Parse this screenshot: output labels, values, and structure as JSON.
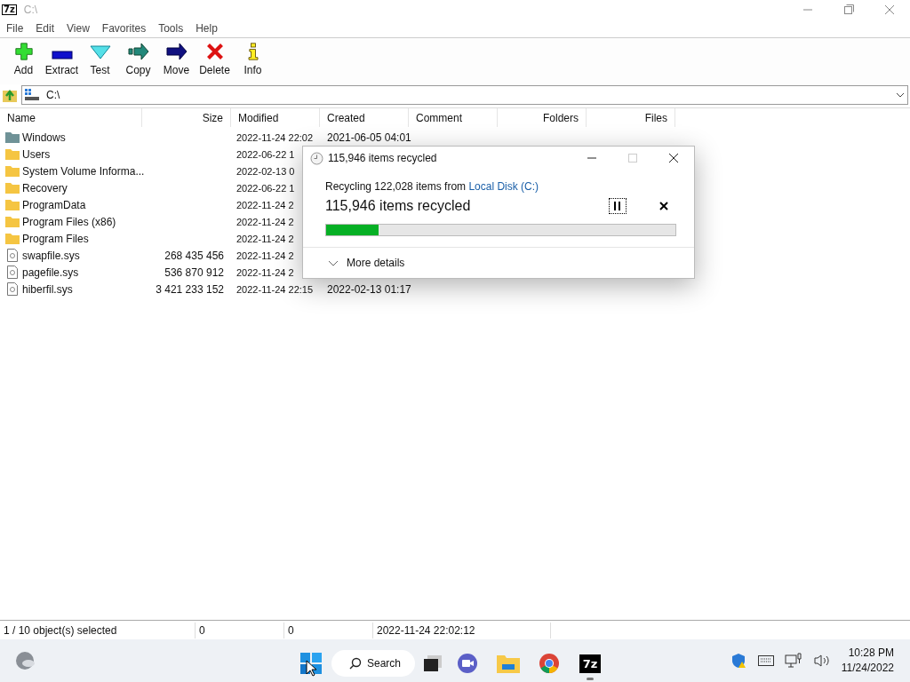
{
  "window": {
    "logo": "7z",
    "title": "C:\\"
  },
  "menu": [
    "File",
    "Edit",
    "View",
    "Favorites",
    "Tools",
    "Help"
  ],
  "toolbar": [
    {
      "kind": "add",
      "label": "Add"
    },
    {
      "kind": "extract",
      "label": "Extract"
    },
    {
      "kind": "test",
      "label": "Test"
    },
    {
      "kind": "copy",
      "label": "Copy"
    },
    {
      "kind": "move",
      "label": "Move"
    },
    {
      "kind": "delete",
      "label": "Delete"
    },
    {
      "kind": "info",
      "label": "Info"
    }
  ],
  "address": {
    "value": "C:\\"
  },
  "table": {
    "columns": [
      "Name",
      "Size",
      "Modified",
      "Created",
      "Comment",
      "Folders",
      "Files"
    ],
    "rows": [
      {
        "kind": "system_folder",
        "name": "Windows",
        "size": "",
        "modified": "2022-11-24 22:02",
        "created": "2021-06-05 04:01"
      },
      {
        "kind": "folder",
        "name": "Users",
        "size": "",
        "modified": "2022-06-22 1",
        "created": ""
      },
      {
        "kind": "folder",
        "name": "System Volume Informa...",
        "size": "",
        "modified": "2022-02-13 0",
        "created": ""
      },
      {
        "kind": "folder",
        "name": "Recovery",
        "size": "",
        "modified": "2022-06-22 1",
        "created": ""
      },
      {
        "kind": "folder",
        "name": "ProgramData",
        "size": "",
        "modified": "2022-11-24 2",
        "created": ""
      },
      {
        "kind": "folder",
        "name": "Program Files (x86)",
        "size": "",
        "modified": "2022-11-24 2",
        "created": ""
      },
      {
        "kind": "folder",
        "name": "Program Files",
        "size": "",
        "modified": "2022-11-24 2",
        "created": ""
      },
      {
        "kind": "file",
        "name": "swapfile.sys",
        "size": "268 435 456",
        "modified": "2022-11-24 2",
        "created": ""
      },
      {
        "kind": "file",
        "name": "pagefile.sys",
        "size": "536 870 912",
        "modified": "2022-11-24 2",
        "created": ""
      },
      {
        "kind": "file",
        "name": "hiberfil.sys",
        "size": "3 421 233 152",
        "modified": "2022-11-24 22:15",
        "created": "2022-02-13 01:17"
      }
    ]
  },
  "status_bar": [
    "1 / 10 object(s) selected",
    "0",
    "0",
    "2022-11-24 22:02:12"
  ],
  "dialog": {
    "title": "115,946 items recycled",
    "line_prefix": "Recycling 122,028 items from",
    "line_link": "Local Disk (C:)",
    "heading": "115,946 items recycled",
    "progress": {
      "level": 0.15
    },
    "paused": false,
    "details": "More details"
  },
  "taskbar": {
    "search": "Search",
    "apps": [
      {
        "kind": "teams"
      },
      {
        "kind": "explorer"
      },
      {
        "kind": "chrome"
      },
      {
        "kind": "sevenzip",
        "logo": "7z",
        "running": true
      }
    ],
    "time": "10:28 PM",
    "date": "11/24/2022"
  }
}
